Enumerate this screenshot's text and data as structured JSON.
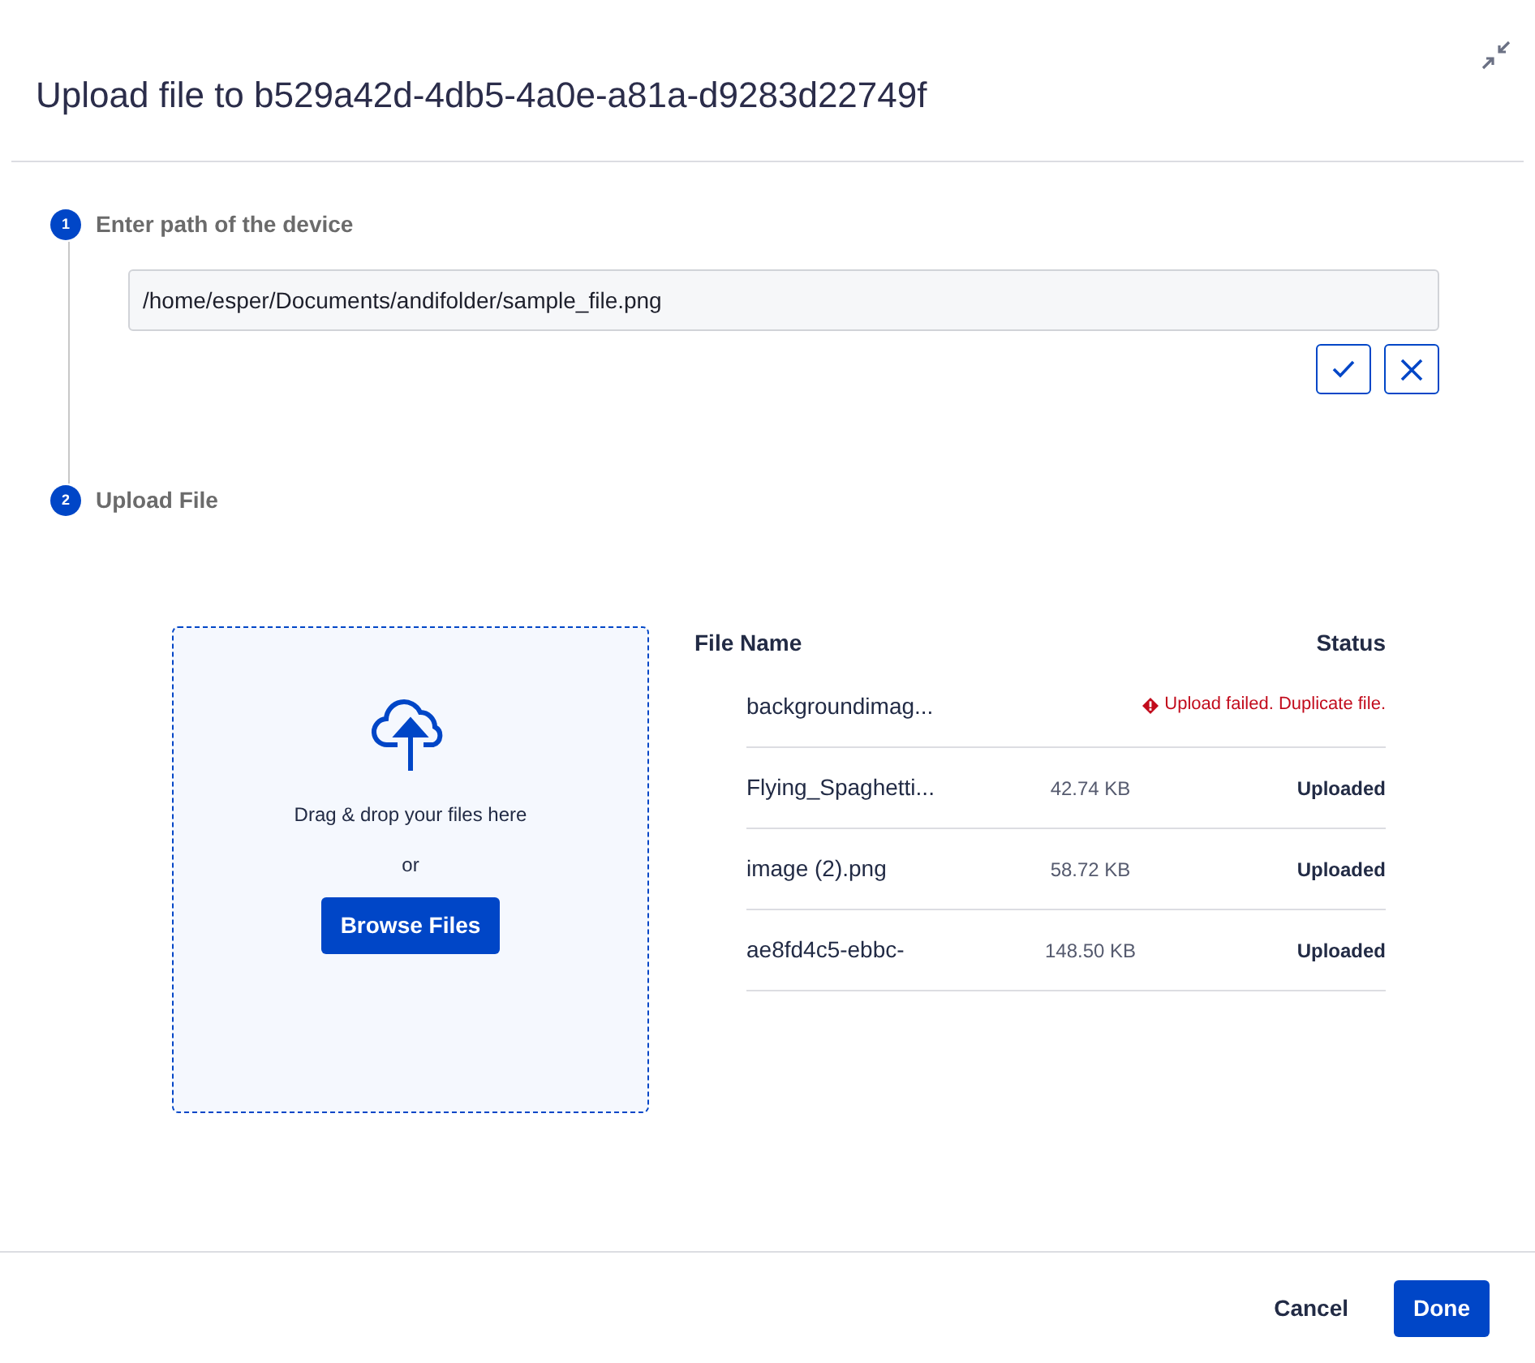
{
  "dialog": {
    "title": "Upload file to b529a42d-4db5-4a0e-a81a-d9283d22749f"
  },
  "steps": [
    {
      "number": "1",
      "label": "Enter path of the device"
    },
    {
      "number": "2",
      "label": "Upload File"
    }
  ],
  "path_field": {
    "value": "/home/esper/Documents/andifolder/sample_file.png"
  },
  "dropzone": {
    "text": "Drag & drop your files here",
    "separator": "or",
    "button": "Browse Files"
  },
  "table": {
    "columns": [
      "File Name",
      "Status"
    ],
    "rows": [
      {
        "name": "backgroundimag...",
        "kind": "failed",
        "status": "Upload failed. Duplicate file."
      },
      {
        "name": "Flying_Spaghetti...",
        "size": "42.74 KB",
        "kind": "uploaded",
        "status": "Uploaded"
      },
      {
        "name": "image (2).png",
        "size": "58.72 KB",
        "kind": "uploaded",
        "status": "Uploaded"
      },
      {
        "name": "ae8fd4c5-ebbc-",
        "size": "148.50 KB",
        "kind": "uploaded",
        "status": "Uploaded"
      }
    ]
  },
  "footer": {
    "buttons": [
      {
        "label": "Cancel",
        "kind": "secondary"
      },
      {
        "label": "Done",
        "kind": "primary"
      }
    ]
  }
}
